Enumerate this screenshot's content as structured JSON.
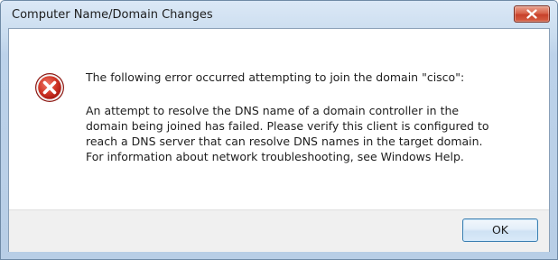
{
  "dialog": {
    "title": "Computer Name/Domain Changes",
    "icon": "error-icon",
    "heading": "The following error occurred attempting to join the domain \"cisco\":",
    "message_lines": [
      "An attempt to resolve the DNS name of a domain controller in the",
      "domain being joined has failed.  Please verify this client is configured to",
      "reach a DNS server that can resolve DNS names in the target domain.",
      "For information about network troubleshooting, see Windows Help."
    ],
    "ok_label": "OK"
  },
  "colors": {
    "close_button": "#c8412a",
    "error_icon": "#c62424",
    "ok_button_border": "#3c7fb1"
  }
}
